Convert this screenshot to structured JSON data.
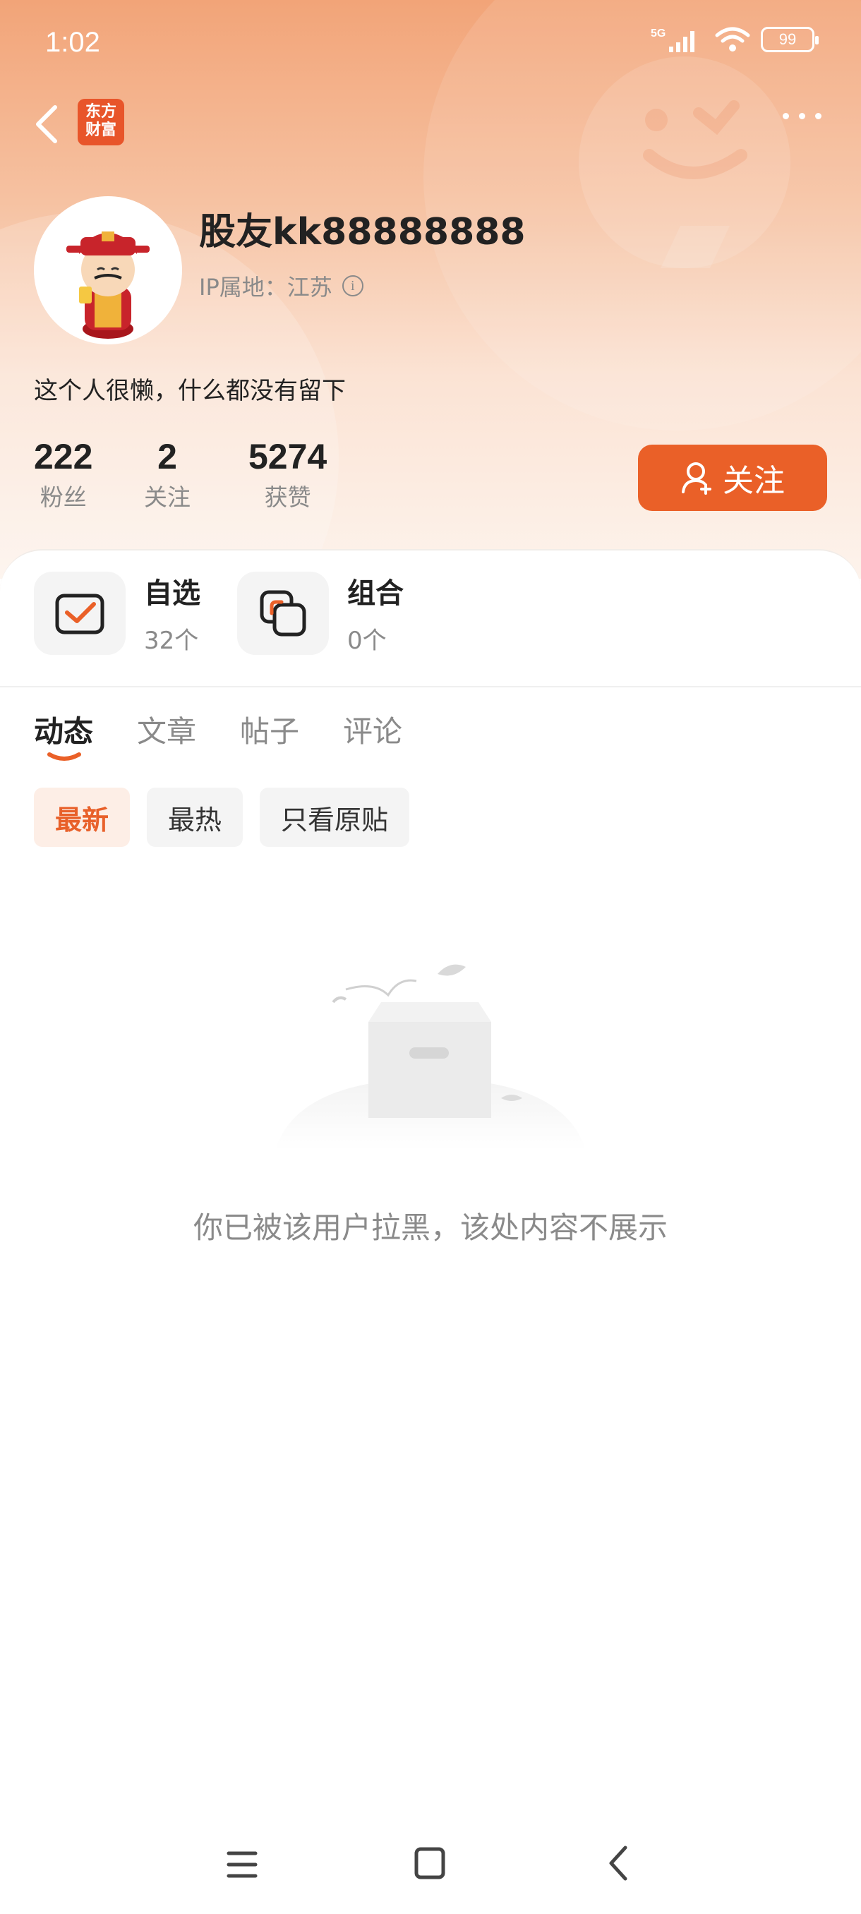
{
  "status_bar": {
    "time": "1:02",
    "signal": "5G",
    "battery": "99"
  },
  "header": {
    "logo_text_line1": "东方",
    "logo_text_line2": "财富"
  },
  "profile": {
    "username": "股友kk88888888",
    "ip_location": "IP属地：江苏",
    "bio": "这个人很懒，什么都没有留下"
  },
  "stats": [
    {
      "value": "222",
      "label": "粉丝"
    },
    {
      "value": "2",
      "label": "关注"
    },
    {
      "value": "5274",
      "label": "获赞"
    }
  ],
  "follow_button": "关注",
  "shortcuts": [
    {
      "title": "自选",
      "count": "32个",
      "icon": "checkbox-icon"
    },
    {
      "title": "组合",
      "count": "0个",
      "icon": "portfolio-icon"
    }
  ],
  "tabs": [
    "动态",
    "文章",
    "帖子",
    "评论"
  ],
  "filters": [
    "最新",
    "最热",
    "只看原贴"
  ],
  "empty_state": {
    "message": "你已被该用户拉黑，该处内容不展示"
  },
  "colors": {
    "accent": "#ea6028",
    "header_top": "#f2a478",
    "muted": "#8a8a8a"
  }
}
